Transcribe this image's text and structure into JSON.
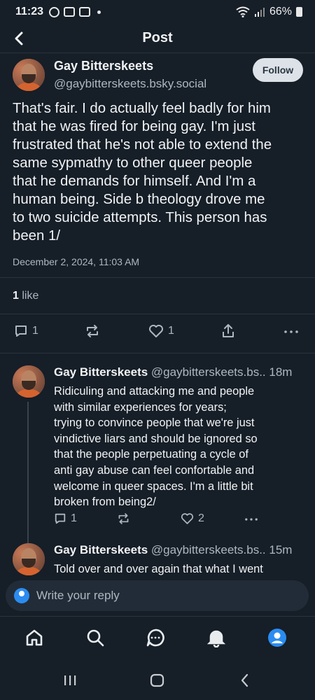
{
  "status": {
    "time": "11:23",
    "battery": "66%"
  },
  "header": {
    "title": "Post"
  },
  "post": {
    "author_name": "Gay Bitterskeets",
    "author_handle": "@gaybitterskeets.bsky.social",
    "follow_label": "Follow",
    "lines": [
      "That's fair. I do actually feel badly for him",
      "that he was fired for being gay. I'm just",
      "frustrated that he's not able to extend the",
      "same sypmathy to other queer people",
      "that he demands for himself. And I'm a",
      "human being. Side b theology drove me",
      "to two suicide attempts. This person has",
      "been 1/"
    ],
    "timestamp": "December 2, 2024, 11:03 AM",
    "like_count": "1",
    "like_label": "like",
    "reply_count": "1",
    "favorite_count": "1"
  },
  "replies": [
    {
      "name": "Gay Bitterskeets",
      "handle": "@gaybitterskeets.bs..",
      "time": "18m",
      "lines": [
        "Ridiculing and attacking me and people",
        "with similar experiences for years;",
        "trying to convince people that we're just",
        "vindictive liars and should be ignored so",
        "that the people perpetuating a cycle of",
        "anti gay abuse can feel confortable and",
        "welcome in queer spaces. I'm a little bit",
        "broken from being2/"
      ],
      "reply_count": "1",
      "like_count": "2"
    },
    {
      "name": "Gay Bitterskeets",
      "handle": "@gaybitterskeets.bs..",
      "time": "15m",
      "lines": [
        "Told over and over again that what I went"
      ]
    }
  ],
  "composer": {
    "placeholder": "Write your reply"
  },
  "icons": {
    "back": "chevron-left-icon",
    "reply": "comment-icon",
    "repost": "repost-icon",
    "like": "heart-icon",
    "share": "share-icon",
    "more": "more-icon",
    "home": "home-icon",
    "search": "search-icon",
    "chat": "chat-icon",
    "notifications": "bell-icon",
    "profile": "profile-icon"
  },
  "colors": {
    "background": "#161e27",
    "accent": "#2b8cf0",
    "muted": "#aeb7c1"
  }
}
